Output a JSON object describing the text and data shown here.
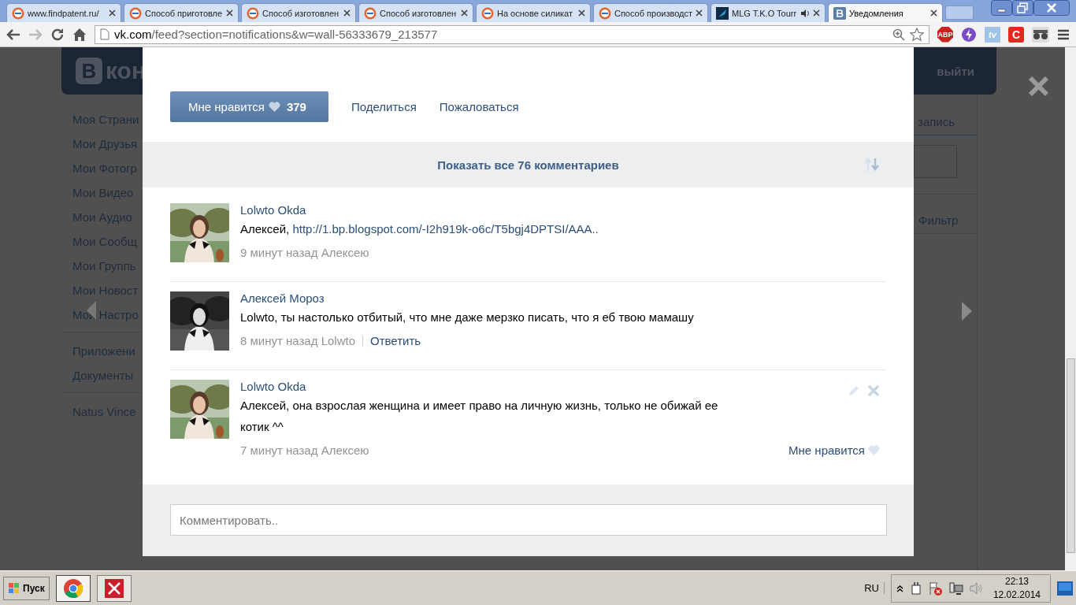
{
  "browser": {
    "tabs": [
      {
        "kind": "patent",
        "title": "www.findpatent.ru/",
        "selected": false,
        "audio": false
      },
      {
        "kind": "patent",
        "title": "Способ приготовле",
        "selected": false,
        "audio": false
      },
      {
        "kind": "patent",
        "title": "Способ изготовлен",
        "selected": false,
        "audio": false
      },
      {
        "kind": "patent",
        "title": "Способ изготовлен",
        "selected": false,
        "audio": false
      },
      {
        "kind": "patent",
        "title": "На основе силикат",
        "selected": false,
        "audio": false
      },
      {
        "kind": "patent",
        "title": "Способ производст",
        "selected": false,
        "audio": false
      },
      {
        "kind": "game",
        "title": "MLG T.K.O Tourr",
        "selected": false,
        "audio": true
      },
      {
        "kind": "social",
        "title": "Уведомления",
        "selected": true,
        "audio": false
      }
    ],
    "address": {
      "host": "vk.com",
      "path": "/feed?section=notifications&w=wall-56333679_213577"
    },
    "extensions": [
      {
        "kind": "abp",
        "label": "ABP"
      },
      {
        "kind": "bolt"
      },
      {
        "kind": "tv",
        "label": "tv"
      },
      {
        "kind": "c",
        "label": "C"
      },
      {
        "kind": "glasses"
      }
    ]
  },
  "background_page": {
    "logo": {
      "mark": "В",
      "text": "кон"
    },
    "logout": "выйти",
    "menu_groups": [
      [
        "Моя Страни",
        "Мои Друзья",
        "Мои Фотогр",
        "Мои Видео",
        "Мои Аудио",
        "Мои Сообщ",
        "Мои Группь",
        "Мои Новост",
        "Мои Настро"
      ],
      [
        "Приложени",
        "Документы"
      ],
      [
        "Natus Vince"
      ]
    ],
    "right_tab": "запись",
    "filter": "Фильтр"
  },
  "post": {
    "like": {
      "label": "Мне нравится",
      "count": "379"
    },
    "share": "Поделиться",
    "report": "Пожаловаться",
    "show_all": "Показать все 76 комментариев",
    "comments": [
      {
        "author": "Lolwto Okda",
        "text": "Алексей, ",
        "link": "http://1.bp.blogspot.com/-I2h919k-o6c/T5bgj4DPTSI/AAA..",
        "time": "9 минут назад",
        "to": "Алексею",
        "own": false
      },
      {
        "author": "Алексей Мороз",
        "text": "Lolwto, ты настолько отбитый, что мне даже мерзко писать, что я еб твою мамашу",
        "time": "8 минут назад",
        "to": "Lolwto",
        "reply": "Ответить",
        "own": false
      },
      {
        "author": "Lolwto Okda",
        "text": "Алексей, она взрослая женщина и имеет право на личную жизнь, только не обижай ее котик ^^",
        "time": "7 минут назад",
        "to": "Алексею",
        "like": "Мне нравится",
        "own": true
      }
    ],
    "comment_field": {
      "placeholder": "Комментировать.."
    }
  },
  "taskbar": {
    "start": "Пуск",
    "language": "RU",
    "time": "22:13",
    "date": "12.02.2014"
  }
}
